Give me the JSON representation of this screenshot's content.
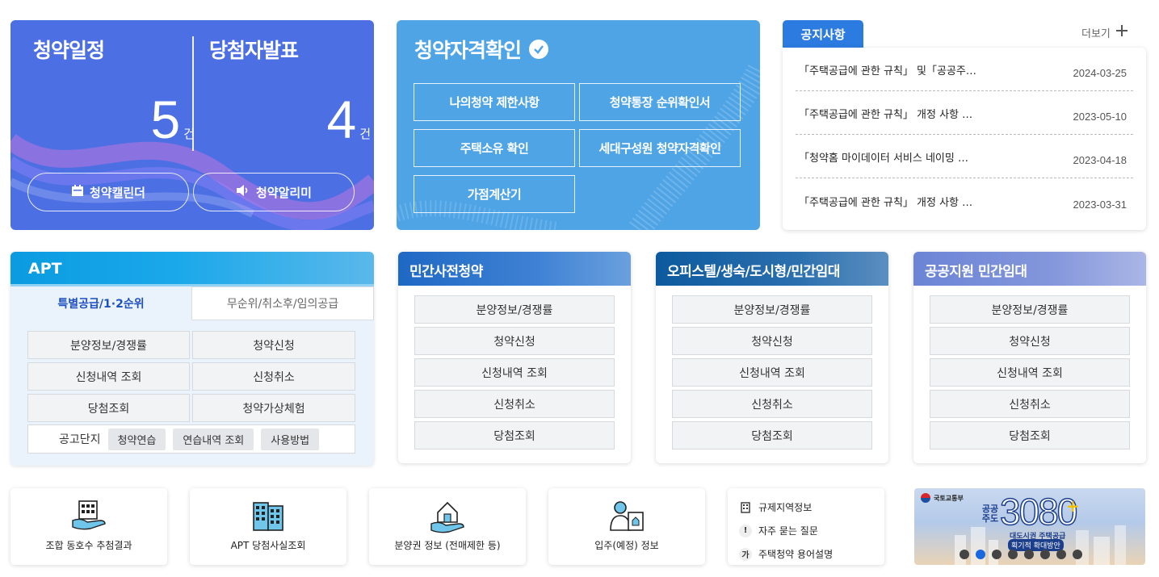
{
  "schedule": {
    "left_title": "청약일정",
    "left_count": "5",
    "right_title": "당첨자발표",
    "right_count": "4",
    "unit": "건",
    "calendar_label": "청약캘린더",
    "alarm_label": "청약알리미"
  },
  "eligibility": {
    "title": "청약자격확인",
    "buttons": [
      "나의청약 제한사항",
      "청약통장 순위확인서",
      "주택소유 확인",
      "세대구성원 청약자격확인",
      "가점계산기"
    ]
  },
  "notice": {
    "tab": "공지사항",
    "more": "더보기",
    "items": [
      {
        "title": "「주택공급에 관한 규칙」 및「공공주…",
        "date": "2024-03-25"
      },
      {
        "title": "「주택공급에 관한 규칙」 개정 사항 …",
        "date": "2023-05-10"
      },
      {
        "title": "「청약홈 마이데이터 서비스 네이밍 …",
        "date": "2023-04-18"
      },
      {
        "title": "「주택공급에 관한 규칙」 개정 사항 …",
        "date": "2023-03-31"
      }
    ]
  },
  "apt": {
    "title": "APT",
    "tab_active": "특별공급/1·2순위",
    "tab_inactive": "무순위/취소후/임의공급",
    "buttons": [
      "분양정보/경쟁률",
      "청약신청",
      "신청내역 조회",
      "신청취소",
      "당첨조회",
      "청약가상체험"
    ],
    "footer_label": "공고단지",
    "chips": [
      "청약연습",
      "연습내역 조회",
      "사용방법"
    ]
  },
  "cards": [
    {
      "title": "민간사전청약",
      "buttons": [
        "분양정보/경쟁률",
        "청약신청",
        "신청내역 조회",
        "신청취소",
        "당첨조회"
      ]
    },
    {
      "title": "오피스텔/생숙/도시형/민간임대",
      "buttons": [
        "분양정보/경쟁률",
        "청약신청",
        "신청내역 조회",
        "신청취소",
        "당첨조회"
      ]
    },
    {
      "title": "공공지원 민간임대",
      "buttons": [
        "분양정보/경쟁률",
        "청약신청",
        "신청내역 조회",
        "신청취소",
        "당첨조회"
      ]
    }
  ],
  "quick": [
    {
      "label": "조합 동호수 추첨결과",
      "icon": "building-hand-icon"
    },
    {
      "label": "APT 당첨사실조회",
      "icon": "apartment-icon"
    },
    {
      "label": "분양권 정보 (전매제한 등)",
      "icon": "house-hand-icon"
    },
    {
      "label": "입주(예정) 정보",
      "icon": "resident-icon"
    }
  ],
  "links": [
    {
      "label": "규제지역정보",
      "icon": "building-icon"
    },
    {
      "label": "자주 묻는 질문",
      "icon": "exclamation-icon"
    },
    {
      "label": "주택청약 용어설명",
      "icon": "ga-icon"
    }
  ],
  "banner": {
    "ministry": "국토교통부",
    "slogan_small": "공공 주도",
    "number": "3080",
    "plus": "+",
    "line1": "대도시권 주택공급",
    "line2": "획기적 확대방안",
    "dot_count": 8,
    "active_dot": 1
  },
  "colors": {
    "schedule_bg": "#4d6fe4",
    "eligibility_bg": "#4fa4e6",
    "notice_tab": "#2b7be0",
    "apt_head": "#0a9be0",
    "private_head": "#1e68c4",
    "officetel_head": "#0c5a9e",
    "public_head": "#6c84d6"
  }
}
